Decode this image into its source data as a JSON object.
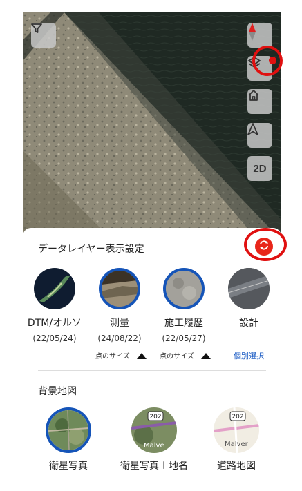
{
  "map_controls": {
    "filter_icon": "filter-icon",
    "compass_icon": "compass-icon",
    "layers_icon": "layers-icon",
    "home_icon": "home-icon",
    "navigate_icon": "navigation-arrow-icon",
    "mode_label": "2D"
  },
  "panel": {
    "title": "データレイヤー表示設定",
    "refresh_icon": "refresh-icon",
    "layers": [
      {
        "name": "DTM/オルソ",
        "date": "(22/05/24)",
        "selected": false
      },
      {
        "name": "測量",
        "date": "(24/08/22)",
        "selected": true
      },
      {
        "name": "施工履歴",
        "date": "(22/05/27)",
        "selected": true
      },
      {
        "name": "設計",
        "date": "",
        "selected": false
      }
    ],
    "point_size_label_1": "点のサイズ",
    "point_size_label_2": "点のサイズ",
    "individual_select": "個別選択"
  },
  "background": {
    "title": "背景地図",
    "maps": [
      {
        "name": "衛星写真",
        "selected": true
      },
      {
        "name": "衛星写真＋地名",
        "selected": false,
        "badge": "202",
        "place": "Malve"
      },
      {
        "name": "道路地図",
        "selected": false,
        "badge": "202",
        "place": "Malver"
      }
    ]
  },
  "colors": {
    "accent_blue": "#1554b8",
    "highlight_red": "#e01010",
    "refresh_red": "#e8261a"
  }
}
